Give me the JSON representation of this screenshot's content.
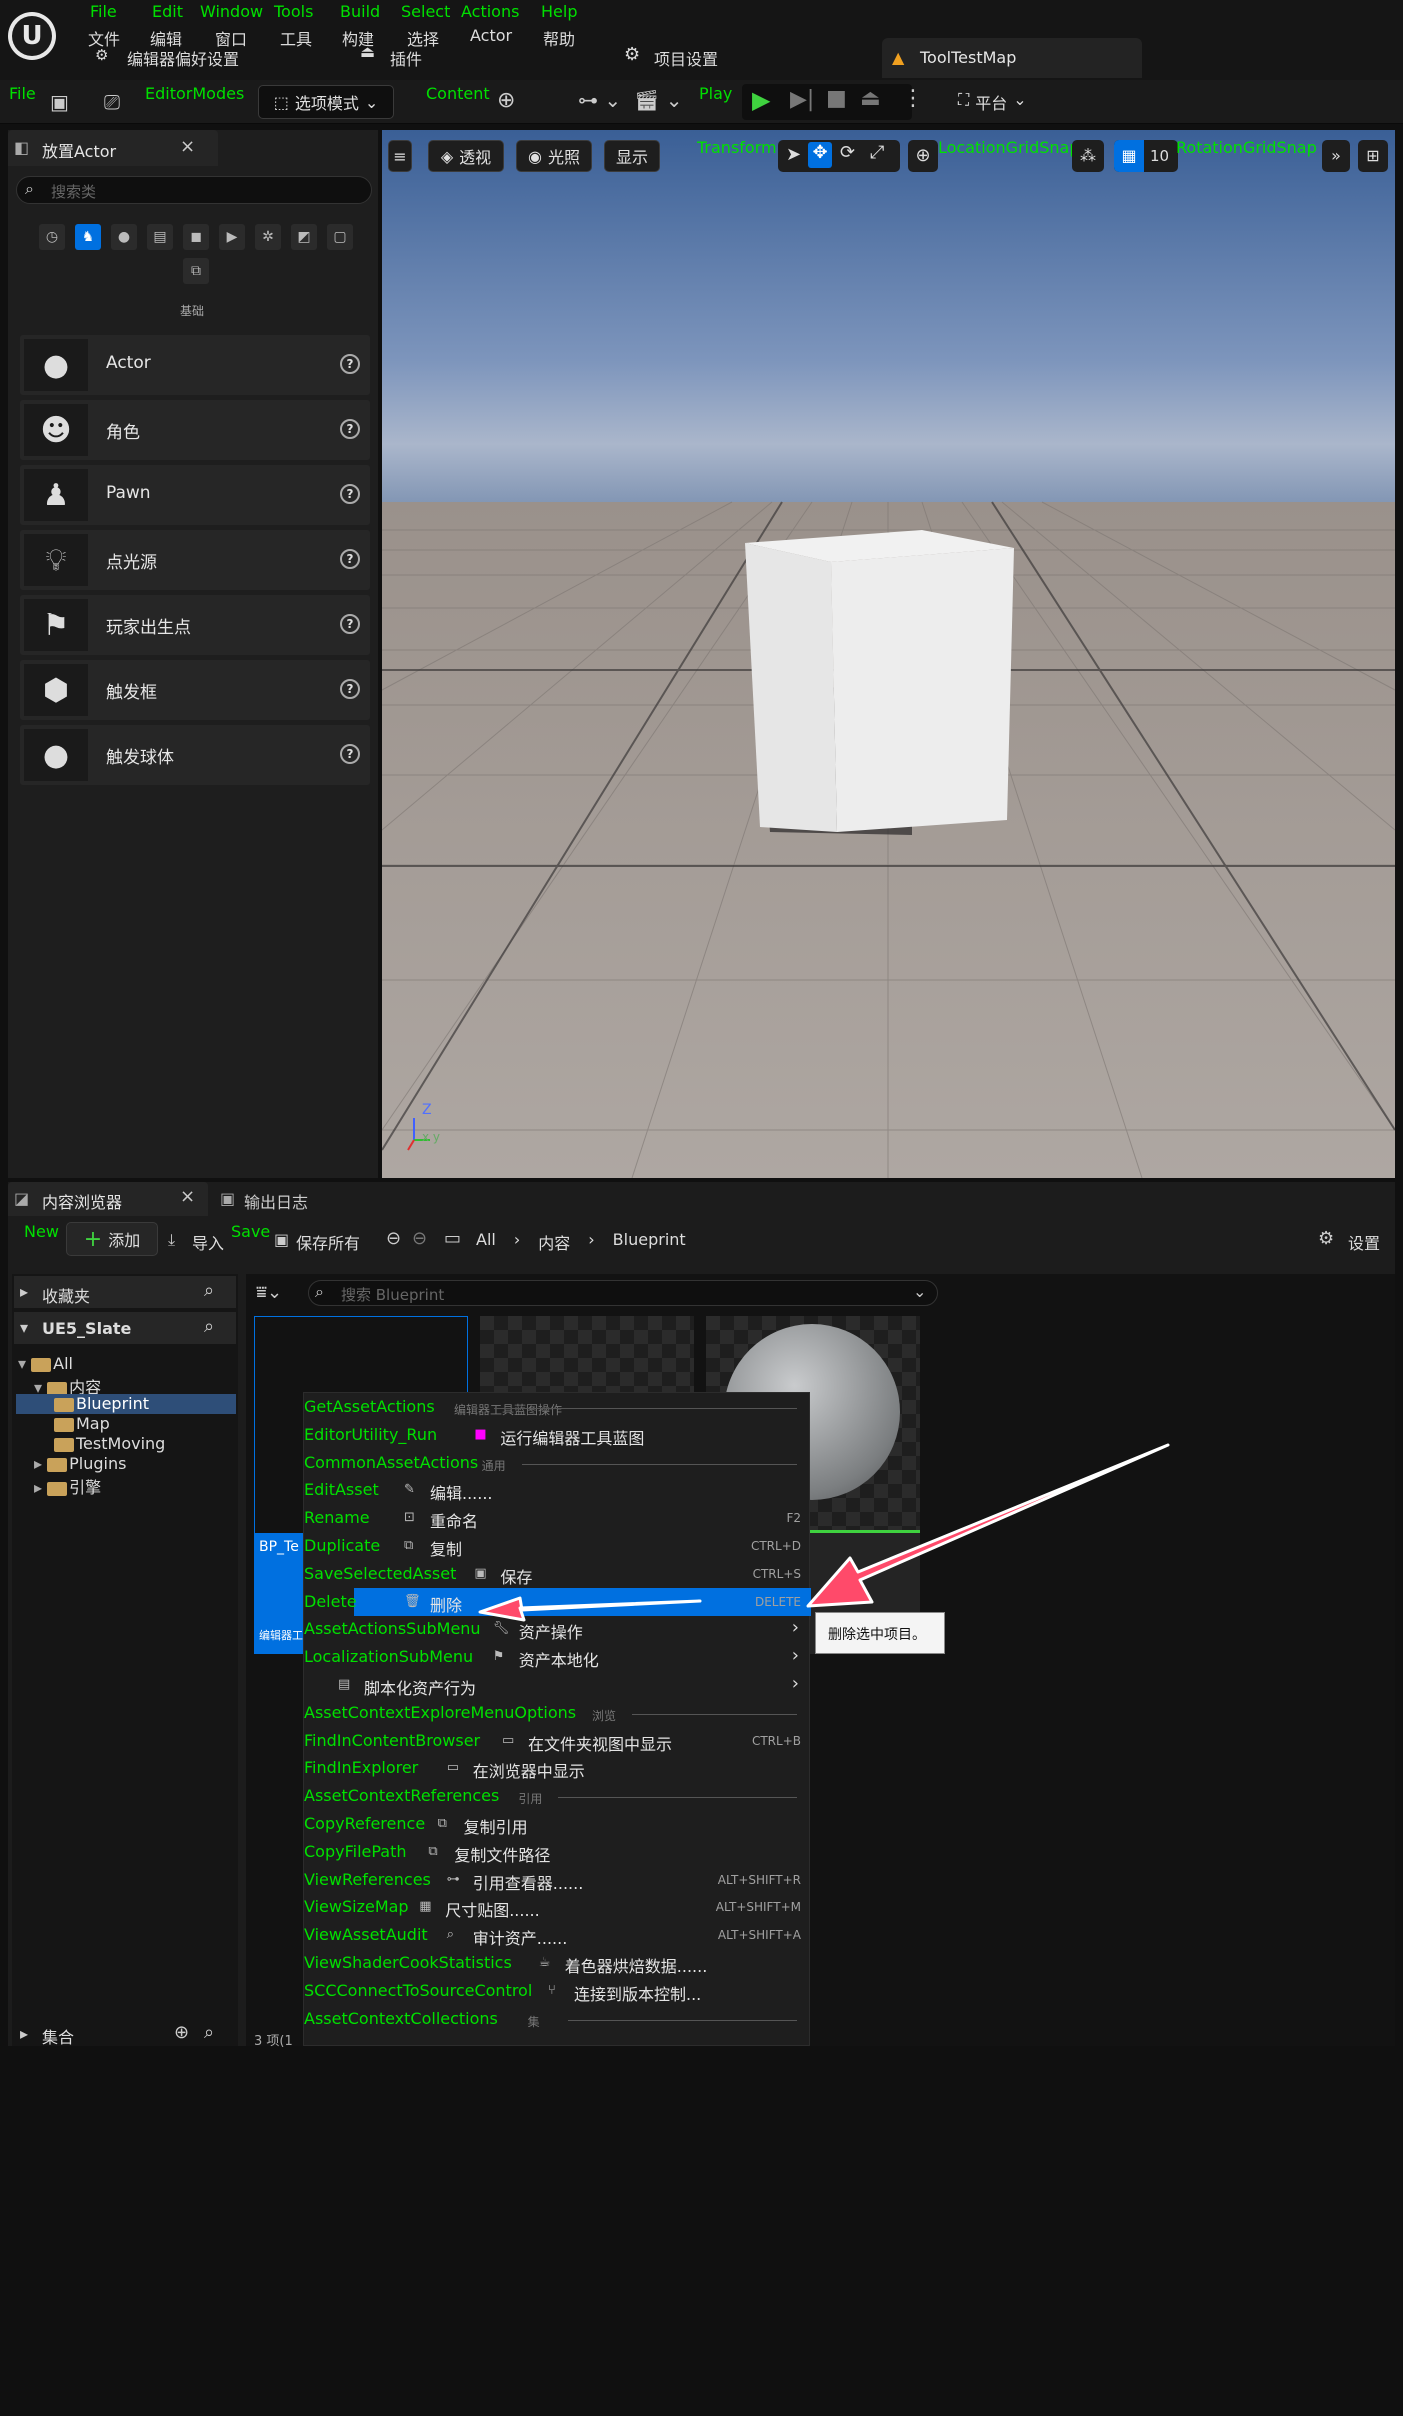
{
  "title_bar": {
    "menu_en": [
      "File",
      "Edit",
      "Window",
      "Tools",
      "Build",
      "Select",
      "Actions",
      "Help"
    ],
    "menu_zh": [
      "文件",
      "编辑",
      "窗口",
      "工具",
      "构建",
      "选择",
      "Actor",
      "帮助"
    ],
    "pref": "编辑器偏好设置",
    "plugins": "插件",
    "project_settings": "项目设置",
    "map_tab": "ToolTestMap"
  },
  "toolbar": {
    "file": "File",
    "editor_modes": "EditorModes",
    "mode_select": "选项模式",
    "content": "Content",
    "play": "Play",
    "platform": "平台"
  },
  "place_actor": {
    "tab": "放置Actor",
    "search_placeholder": "搜索类",
    "category": "基础",
    "items": [
      "Actor",
      "角色",
      "Pawn",
      "点光源",
      "玩家出生点",
      "触发框",
      "触发球体"
    ]
  },
  "viewport": {
    "menu": "≡",
    "perspective": "透视",
    "lit": "光照",
    "show": "显示",
    "transform": "Transform",
    "loc_snap": "LocationGridSnap",
    "rot_snap": "RotationGridSnap",
    "grid_value": "10",
    "axis_z": "Z",
    "axis_xy": "x  y"
  },
  "content_browser": {
    "tab": "内容浏览器",
    "log_tab": "输出日志",
    "new": "New",
    "add": "添加",
    "import": "导入",
    "save": "Save",
    "save_all": "保存所有",
    "crumbs": [
      "All",
      "内容",
      "Blueprint"
    ],
    "settings": "设置",
    "favorites": "收藏夹",
    "project": "UE5_Slate",
    "search_placeholder": "搜索 Blueprint",
    "tree": [
      "All",
      "内容",
      "Blueprint",
      "Map",
      "TestMoving",
      "Plugins",
      "引擎"
    ],
    "collections": "集合",
    "item_count": "3 项(1",
    "asset_name": "BP_Te",
    "asset_type": "编辑器工"
  },
  "context_menu": {
    "rows": [
      {
        "key": "GetAssetActions",
        "label": "编辑器工具蓝图操作",
        "section": true
      },
      {
        "key": "EditorUtility_Run",
        "label": "运行编辑器工具蓝图",
        "icon": "magenta-square"
      },
      {
        "key": "CommonAssetActions",
        "label": "通用",
        "section": true
      },
      {
        "key": "EditAsset",
        "label": "编辑......",
        "icon": "pencil-icon"
      },
      {
        "key": "Rename",
        "label": "重命名",
        "shortcut": "F2"
      },
      {
        "key": "Duplicate",
        "label": "复制",
        "shortcut": "CTRL+D"
      },
      {
        "key": "SaveSelectedAsset",
        "label": "保存",
        "shortcut": "CTRL+S"
      },
      {
        "key": "Delete",
        "label": "删除",
        "shortcut": "DELETE",
        "highlight": true
      },
      {
        "key": "AssetActionsSubMenu",
        "label": "资产操作",
        "submenu": true
      },
      {
        "key": "LocalizationSubMenu",
        "label": "资产本地化",
        "submenu": true
      },
      {
        "key": "",
        "label": "脚本化资产行为",
        "submenu": true
      },
      {
        "key": "AssetContextExploreMenuOptions",
        "label": "浏览",
        "section": true
      },
      {
        "key": "FindInContentBrowser",
        "label": "在文件夹视图中显示",
        "shortcut": "CTRL+B"
      },
      {
        "key": "FindInExplorer",
        "label": "在浏览器中显示"
      },
      {
        "key": "AssetContextReferences",
        "label": "引用",
        "section": true
      },
      {
        "key": "CopyReference",
        "label": "复制引用"
      },
      {
        "key": "CopyFilePath",
        "label": "复制文件路径"
      },
      {
        "key": "ViewReferences",
        "label": "引用查看器......",
        "shortcut": "ALT+SHIFT+R"
      },
      {
        "key": "ViewSizeMap",
        "label": "尺寸贴图......",
        "shortcut": "ALT+SHIFT+M"
      },
      {
        "key": "ViewAssetAudit",
        "label": "审计资产......",
        "shortcut": "ALT+SHIFT+A"
      },
      {
        "key": "ViewShaderCookStatistics",
        "label": "着色器烘焙数据......"
      },
      {
        "key": "SCCConnectToSourceControl",
        "label": "连接到版本控制..."
      },
      {
        "key": "AssetContextCollections",
        "label": "集",
        "section": true
      }
    ],
    "tooltip": "删除选中项目。"
  },
  "colors": {
    "accent": "#0070e0",
    "annotation": "#00e000",
    "arrow": "#ff4a6a"
  }
}
